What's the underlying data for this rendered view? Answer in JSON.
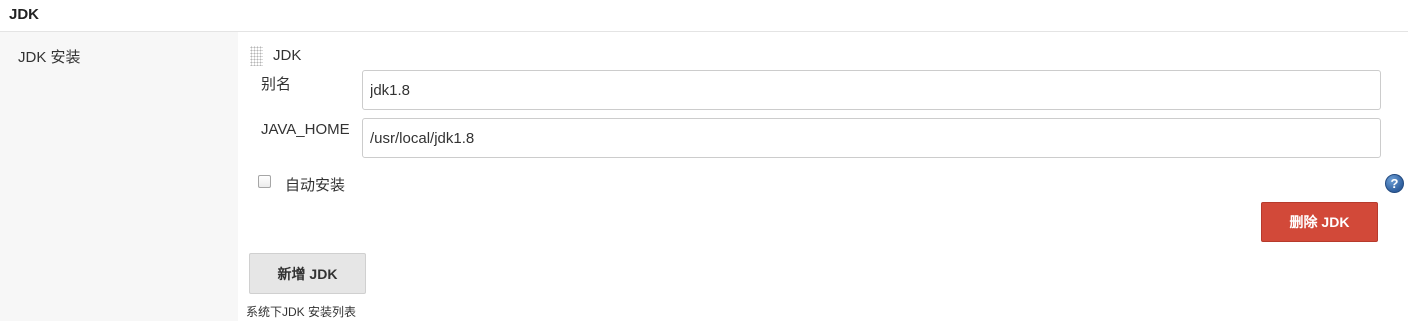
{
  "section": {
    "title": "JDK"
  },
  "setting": {
    "label": "JDK 安装"
  },
  "jdk_block": {
    "title": "JDK",
    "alias_label": "别名",
    "alias_value": "jdk1.8",
    "java_home_label": "JAVA_HOME",
    "java_home_value": "/usr/local/jdk1.8",
    "auto_install_label": "自动安装",
    "auto_install_checked": false,
    "help_icon_text": "?",
    "delete_button": "删除 JDK"
  },
  "add_button": "新增 JDK",
  "description": "系统下JDK 安装列表",
  "colors": {
    "delete_button_bg": "#d24939",
    "add_button_bg": "#e6e6e6",
    "help_icon": "#2f5f9e",
    "left_panel_bg": "#f7f7f7"
  },
  "icons": [
    "drag-handle-icon",
    "help-icon"
  ]
}
